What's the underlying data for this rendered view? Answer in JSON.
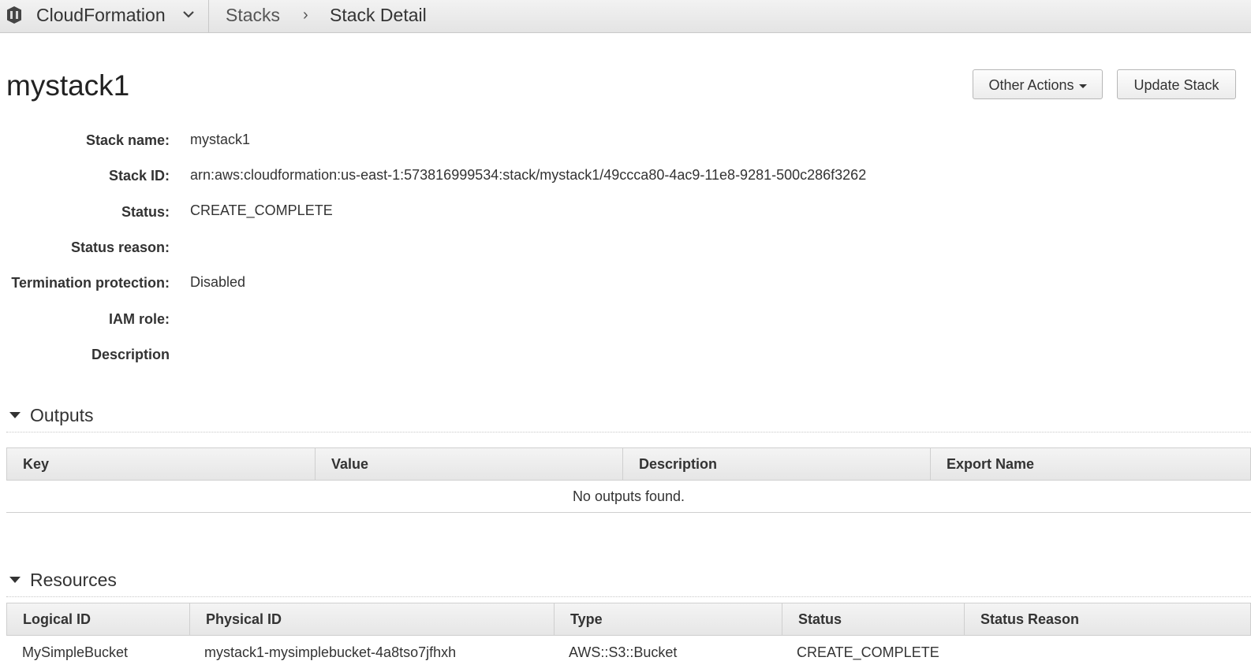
{
  "nav": {
    "service": "CloudFormation",
    "breadcrumb": [
      "Stacks",
      "Stack Detail"
    ],
    "separator": "›"
  },
  "page": {
    "title": "mystack1"
  },
  "actions": {
    "other_actions": "Other Actions",
    "update_stack": "Update Stack"
  },
  "details": [
    {
      "label": "Stack name:",
      "value": "mystack1"
    },
    {
      "label": "Stack ID:",
      "value": "arn:aws:cloudformation:us-east-1:573816999534:stack/mystack1/49ccca80-4ac9-11e8-9281-500c286f3262"
    },
    {
      "label": "Status:",
      "value": "CREATE_COMPLETE"
    },
    {
      "label": "Status reason:",
      "value": ""
    },
    {
      "label": "Termination protection:",
      "value": "Disabled"
    },
    {
      "label": "IAM role:",
      "value": ""
    },
    {
      "label": "Description",
      "value": ""
    }
  ],
  "outputs": {
    "title": "Outputs",
    "columns": [
      "Key",
      "Value",
      "Description",
      "Export Name"
    ],
    "empty_message": "No outputs found."
  },
  "resources": {
    "title": "Resources",
    "columns": [
      "Logical ID",
      "Physical ID",
      "Type",
      "Status",
      "Status Reason"
    ],
    "rows": [
      [
        "MySimpleBucket",
        "mystack1-mysimplebucket-4a8tso7jfhxh",
        "AWS::S3::Bucket",
        "CREATE_COMPLETE",
        ""
      ]
    ]
  },
  "icons": {
    "logo": "cloudformation-logo-icon",
    "caret": "chevron-down-icon",
    "section": "triangle-down-icon"
  }
}
